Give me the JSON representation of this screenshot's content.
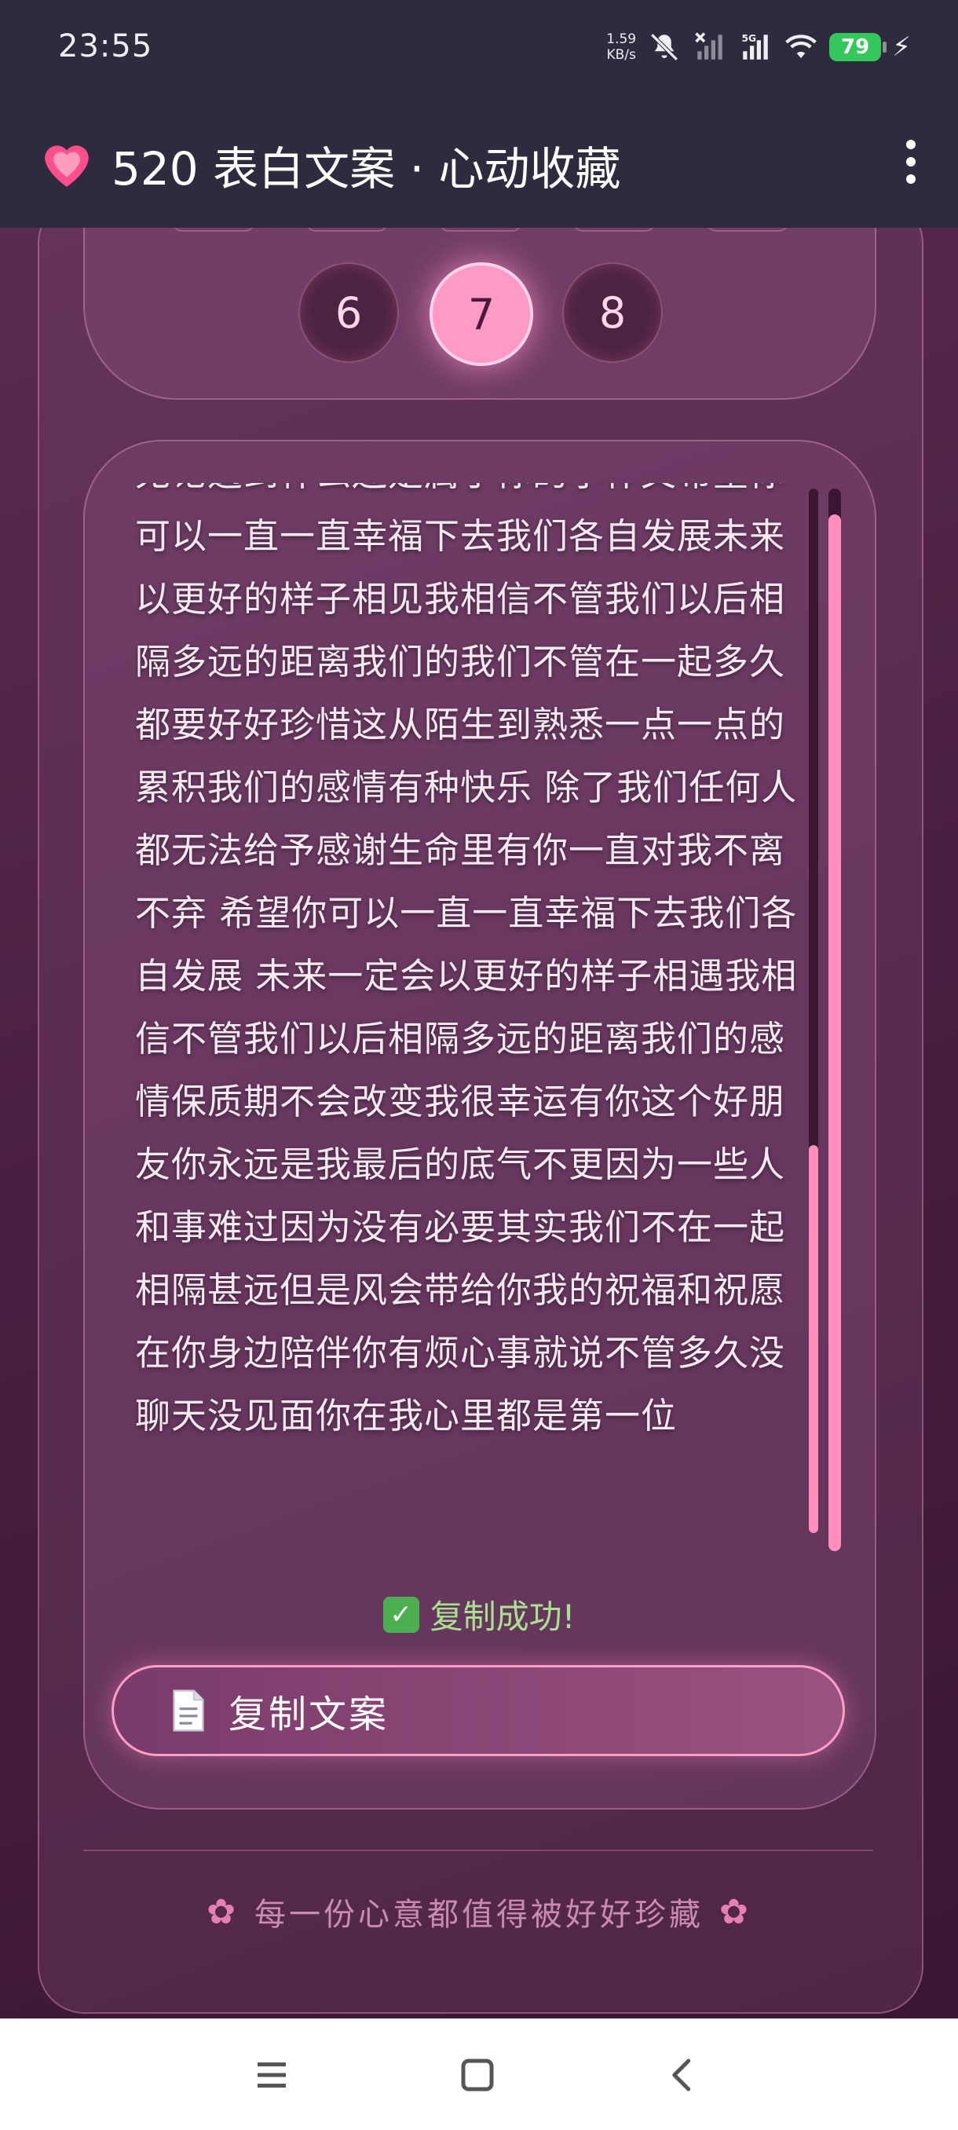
{
  "status_bar": {
    "time": "23:55",
    "net_speed_value": "1.59",
    "net_speed_unit": "KB/s",
    "network_type": "5G",
    "battery_level": "79",
    "icons": [
      "mute-icon",
      "signal-off-icon",
      "signal-icon",
      "wifi-icon",
      "battery-icon",
      "charging-icon"
    ]
  },
  "app_bar": {
    "title": "520 表白文案 · 心动收藏",
    "icon": "heart-icon",
    "menu_icon": "more-vert-icon"
  },
  "pager": {
    "pages": [
      "6",
      "7",
      "8"
    ],
    "active_page": "7"
  },
  "content": {
    "text": "无论遇到什么还是属于你的小作文希望你可以一直一直幸福下去我们各自发展未来以更好的样子相见我相信不管我们以后相隔多远的距离我们的我们不管在一起多久都要好好珍惜这从陌生到熟悉一点一点的累积我们的感情有种快乐 除了我们任何人都无法给予感谢生命里有你一直对我不离不弃 希望你可以一直一直幸福下去我们各自发展 未来一定会以更好的样子相遇我相信不管我们以后相隔多远的距离我们的感情保质期不会改变我很幸运有你这个好朋友你永远是我最后的底气不更因为一些人和事难过因为没有必要其实我们不在一起 相隔甚远但是风会带给你我的祝福和祝愿在你身边陪伴你有烦心事就说不管多久没聊天没见面你在我心里都是第一位"
  },
  "copy_status": "复制成功!",
  "copy_button": {
    "label": "复制文案",
    "icon": "document-icon"
  },
  "footer": {
    "text": "每一份心意都值得被好好珍藏",
    "icon": "cherry-blossom-icon"
  },
  "nav_bar": {
    "buttons": [
      "recents-icon",
      "home-icon",
      "back-icon"
    ]
  },
  "colors": {
    "accent": "#ff9ac7",
    "success": "#a7e38f",
    "appbar": "#2d2b3d"
  }
}
